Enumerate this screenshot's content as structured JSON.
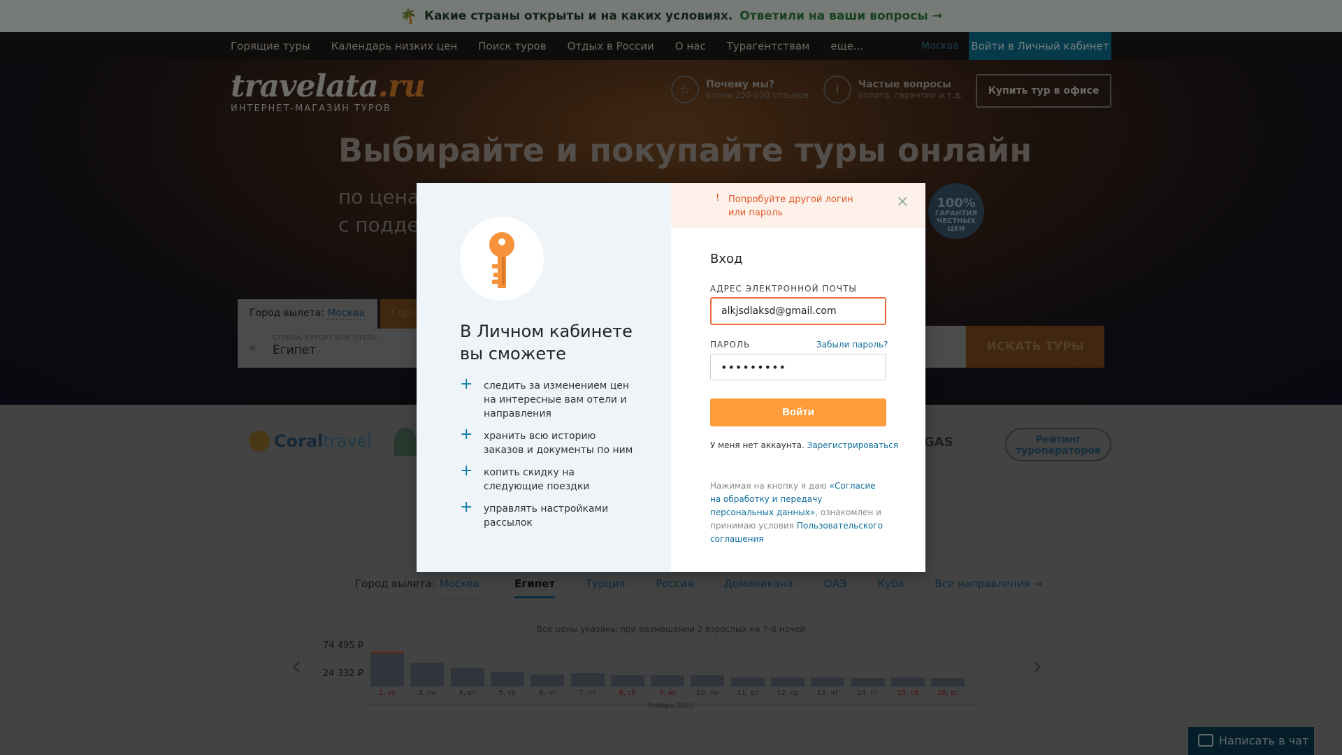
{
  "top_banner": {
    "text": "Какие страны открыты и на каких условиях.",
    "link": "Ответили на ваши вопросы"
  },
  "nav": {
    "items": [
      "Горящие туры",
      "Календарь низких цен",
      "Поиск туров",
      "Отдых в России",
      "О нас",
      "Турагентствам",
      "еще..."
    ],
    "city": "Москва",
    "login": "Войти в Личный кабинет"
  },
  "header": {
    "logo_main": "travelata",
    "logo_ru": ".ru",
    "logo_sub": "ИНТЕРНЕТ-МАГАЗИН ТУРОВ",
    "why_title": "Почему мы?",
    "why_sub": "Более 250 000 отзывов",
    "faq_title": "Частые вопросы",
    "faq_sub": "оплата, гарантии и т.д.",
    "buy_office": "Купить тур в офисе"
  },
  "hero": {
    "title": "Выбирайте и покупайте туры онлайн",
    "sub1": "по цена",
    "sub2": "с подде",
    "guarantee_top": "100%",
    "guarantee_text": "ГАРАНТИЯ ЧЕСТНЫХ ЦЕН"
  },
  "search": {
    "city_label": "Город вылета:",
    "city": "Москва",
    "hot_tab": "Горя",
    "field_label": "СТРАНА, КУРОРТ ИЛИ ОТЕЛЬ",
    "field_value": "Египет",
    "button": "ИСКАТЬ ТУРЫ"
  },
  "partners": {
    "coral_a": "Coral",
    "coral_b": "travel",
    "partner3": "GAS",
    "rating": "Рейтинг туроператоров"
  },
  "calendar": {
    "city_label": "Город вылета:",
    "city": "Москва",
    "tabs": [
      "Египет",
      "Турция",
      "Россия",
      "Доминикана",
      "ОАЭ",
      "Куба"
    ],
    "active_tab": "Египет",
    "all": "Все направления",
    "note": "Все цены указаны при размещении 2 взрослых на 7-8 ночей",
    "y_max": "74 495 ₽",
    "y_min": "24 332 ₽",
    "month": "Январь 2022"
  },
  "chart_data": {
    "type": "bar",
    "categories": [
      "2, вс",
      "3, пн",
      "4, вт",
      "5, ср",
      "6, чт",
      "7, пт",
      "8, сб",
      "9, вс",
      "10, пн",
      "11, вт",
      "12, ср",
      "13, чт",
      "14, пт",
      "15, сб",
      "16, вс"
    ],
    "values": [
      74495,
      55000,
      44000,
      38000,
      33000,
      36000,
      32000,
      32000,
      32000,
      28000,
      28000,
      28000,
      27000,
      28000,
      27000
    ],
    "weekend": [
      true,
      false,
      false,
      false,
      false,
      false,
      true,
      true,
      false,
      false,
      false,
      false,
      false,
      true,
      true
    ],
    "ylim": [
      24332,
      74495
    ],
    "xlabel": "Январь 2022"
  },
  "chat": "Написать в чат",
  "modal": {
    "left_title": "В Личном кабинете вы сможете",
    "benefits": [
      "следить за изменением цен на интересные вам отели и направления",
      "хранить всю историю заказов и документы по ним",
      "копить скидку на следующие поездки",
      "управлять настройками рассылок"
    ],
    "error_icon": "!",
    "error": "Попробуйте другой логин или пароль",
    "close": "×",
    "title": "Вход",
    "email_label": "АДРЕС ЭЛЕКТРОННОЙ ПОЧТЫ",
    "email_value": "alkjsdlaksd@gmail.com",
    "password_label": "ПАРОЛЬ",
    "forgot": "Забыли пароль?",
    "password_value": "•••••••••",
    "login_button": "Войти",
    "no_account": "У меня нет аккаунта.",
    "register": "Зарегистрироваться",
    "legal_1": "Нажимая на кнопку я даю ",
    "legal_link1": "«Согласие на обработку и передачу персональных данных»",
    "legal_2": ", ознакомлен и принимаю условия ",
    "legal_link2": "Пользовательского соглашения"
  },
  "colors": {
    "accent": "#ff9c3b",
    "link": "#0f6e9c",
    "error": "#e05a2a"
  }
}
